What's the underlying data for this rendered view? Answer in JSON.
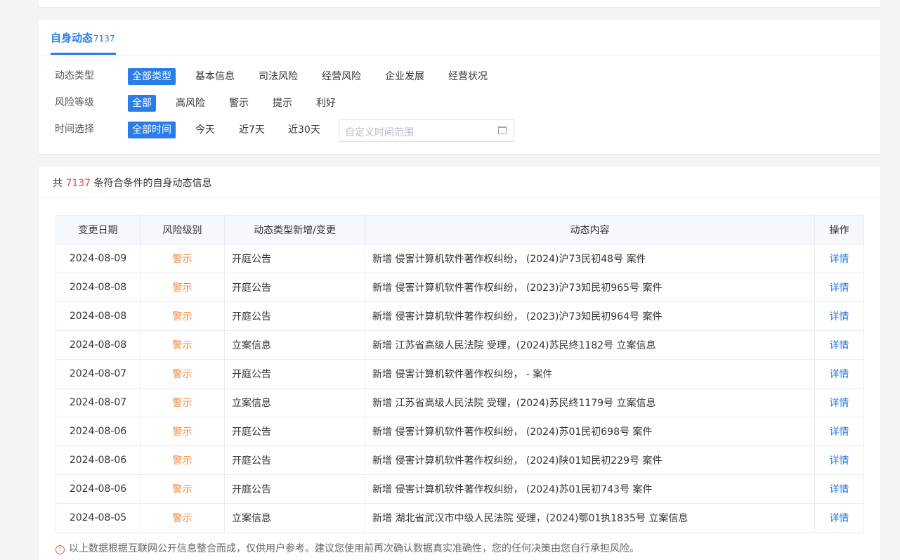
{
  "tab": {
    "title": "自身动态",
    "count": "7137"
  },
  "filters": {
    "type": {
      "label": "动态类型",
      "options": [
        "全部类型",
        "基本信息",
        "司法风险",
        "经营风险",
        "企业发展",
        "经营状况"
      ]
    },
    "risk": {
      "label": "风险等级",
      "options": [
        "全部",
        "高风险",
        "警示",
        "提示",
        "利好"
      ]
    },
    "time": {
      "label": "时间选择",
      "options": [
        "全部时间",
        "今天",
        "近7天",
        "近30天"
      ],
      "custom_placeholder": "自定义时间范围"
    }
  },
  "summary": {
    "prefix": "共 ",
    "count": "7137",
    "suffix": " 条符合条件的自身动态信息"
  },
  "table": {
    "headers": [
      "变更日期",
      "风险级别",
      "动态类型新增/变更",
      "动态内容",
      "操作"
    ],
    "rows": [
      {
        "date": "2024-08-09",
        "risk": "警示",
        "type": "开庭公告",
        "content": "新增 侵害计算机软件著作权纠纷， (2024)沪73民初48号 案件",
        "action": "详情"
      },
      {
        "date": "2024-08-08",
        "risk": "警示",
        "type": "开庭公告",
        "content": "新增 侵害计算机软件著作权纠纷， (2023)沪73知民初965号 案件",
        "action": "详情"
      },
      {
        "date": "2024-08-08",
        "risk": "警示",
        "type": "开庭公告",
        "content": "新增 侵害计算机软件著作权纠纷， (2023)沪73知民初964号 案件",
        "action": "详情"
      },
      {
        "date": "2024-08-08",
        "risk": "警示",
        "type": "立案信息",
        "content": "新增 江苏省高级人民法院 受理，(2024)苏民终1182号 立案信息",
        "action": "详情"
      },
      {
        "date": "2024-08-07",
        "risk": "警示",
        "type": "开庭公告",
        "content": "新增 侵害计算机软件著作权纠纷， - 案件",
        "action": "详情"
      },
      {
        "date": "2024-08-07",
        "risk": "警示",
        "type": "立案信息",
        "content": "新增 江苏省高级人民法院 受理，(2024)苏民终1179号 立案信息",
        "action": "详情"
      },
      {
        "date": "2024-08-06",
        "risk": "警示",
        "type": "开庭公告",
        "content": "新增 侵害计算机软件著作权纠纷， (2024)苏01民初698号 案件",
        "action": "详情"
      },
      {
        "date": "2024-08-06",
        "risk": "警示",
        "type": "开庭公告",
        "content": "新增 侵害计算机软件著作权纠纷， (2024)陕01知民初229号 案件",
        "action": "详情"
      },
      {
        "date": "2024-08-06",
        "risk": "警示",
        "type": "开庭公告",
        "content": "新增 侵害计算机软件著作权纠纷， (2024)苏01民初743号 案件",
        "action": "详情"
      },
      {
        "date": "2024-08-05",
        "risk": "警示",
        "type": "立案信息",
        "content": "新增 湖北省武汉市中级人民法院 受理，(2024)鄂01执1835号 立案信息",
        "action": "详情"
      }
    ]
  },
  "disclaimer": "以上数据根据互联网公开信息整合而成，仅供用户参考。建议您使用前再次确认数据真实准确性，您的任何决策由您自行承担风险。",
  "colors": {
    "accent": "#2a7de8",
    "risk_warn": "#f08a3c",
    "count_red": "#e84e40"
  },
  "icons": {
    "date_picker": "calendar-icon",
    "disclaimer": "warning-icon"
  }
}
